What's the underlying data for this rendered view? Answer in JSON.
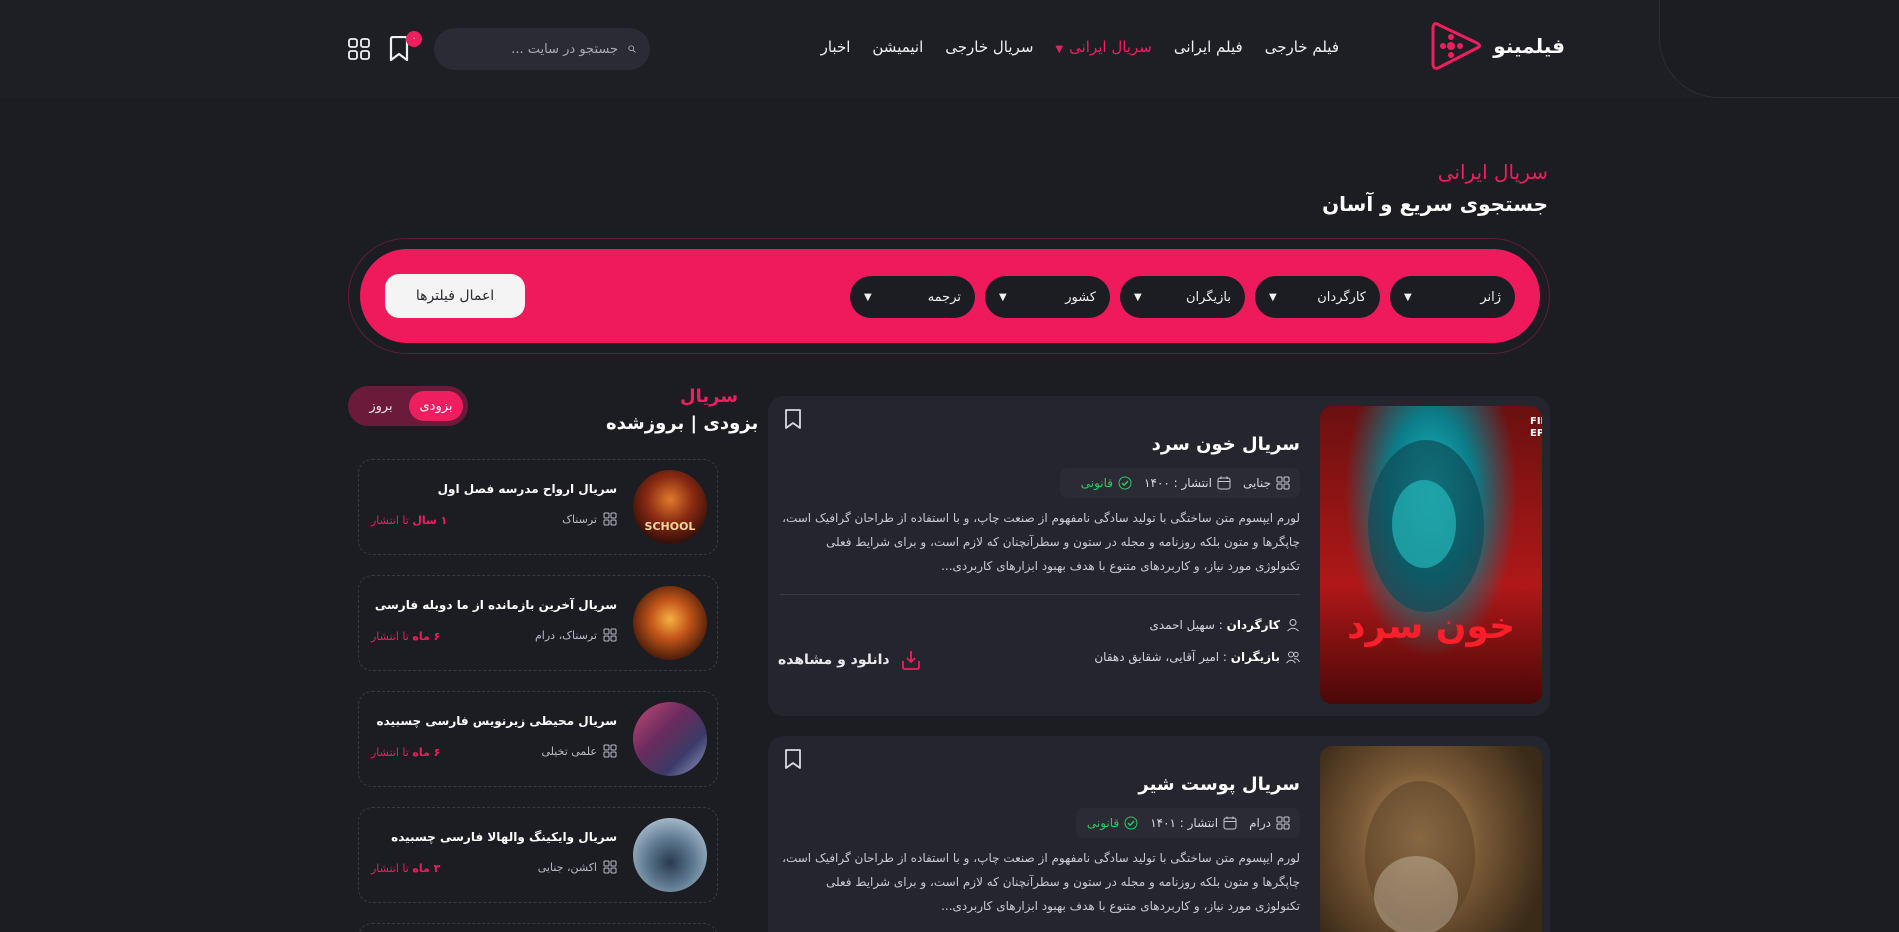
{
  "colors": {
    "accent": "#ef1e5e",
    "background": "#1c1c23",
    "card": "#25252d",
    "success": "#2ec76b"
  },
  "header": {
    "brand": "فیلمینو",
    "nav": [
      {
        "label": "فیلم خارجی"
      },
      {
        "label": "فیلم ایرانی"
      },
      {
        "label": "سریال ایرانی",
        "active": true
      },
      {
        "label": "سریال خارجی"
      },
      {
        "label": "انیمیشن"
      },
      {
        "label": "اخبار"
      }
    ],
    "search_placeholder": "جستجو در سایت ...",
    "bookmark_count": "۰"
  },
  "hero": {
    "label": "سریال ایرانی",
    "title": "جستجوی سریع و آسان"
  },
  "filters": {
    "items": [
      "ژانر",
      "کارگردان",
      "بازیگران",
      "کشور",
      "ترجمه"
    ],
    "apply_label": "اعمال فیلترها"
  },
  "sidebar": {
    "label": "سریال",
    "title": "بزودی | بروزشده",
    "toggle": {
      "on": "بزودی",
      "off": "بروز"
    },
    "items": [
      {
        "title": "سریال ارواح مدرسه فصل اول",
        "genre": "ترسناک",
        "time_num": "۱ سال",
        "time_suffix": " تا انتشار"
      },
      {
        "title": "سریال آخرین بازمانده از ما دوبله فارسی",
        "genre": "ترسناک، درام",
        "time_num": "۶ ماه",
        "time_suffix": " تا انتشار"
      },
      {
        "title": "سریال محیطی زیرنویس فارسی چسبیده",
        "genre": "علمی تخیلی",
        "time_num": "۶ ماه",
        "time_suffix": " تا انتشار"
      },
      {
        "title": "سریال وایکینگ والهالا فارسی چسبیده",
        "genre": "اکشن، جنایی",
        "time_num": "۳ ماه",
        "time_suffix": " تا انتشار"
      }
    ]
  },
  "cards": [
    {
      "title": "سریال خون سرد",
      "genre": "جنایی",
      "release": "انتشار : ۱۴۰۰",
      "status": "قانونی",
      "description": "لورم ایپسوم متن ساختگی با تولید سادگی نامفهوم از صنعت چاپ، و با استفاده از طراحان گرافیک است، چاپگرها و متون بلکه روزنامه و مجله در ستون و سطرآنچنان که لازم است، و برای شرایط فعلی تکنولوژی مورد نیاز، و کاربردهای متنوع با هدف بهبود ابزارهای کاربردی...",
      "director_label": "کارگردان",
      "director": " : سهیل احمدی",
      "cast_label": "بازیگران",
      "cast": " : امیر آقایی، شقایق دهقان",
      "download_label": "دانلود و مشاهده",
      "poster_text": "خون سرد",
      "poster_badge": "FINAL EPISODE"
    },
    {
      "title": "سریال پوست شیر",
      "genre": "درام",
      "release": "انتشار : ۱۴۰۱",
      "status": "قانونی",
      "description": "لورم ایپسوم متن ساختگی با تولید سادگی نامفهوم از صنعت چاپ، و با استفاده از طراحان گرافیک است، چاپگرها و متون بلکه روزنامه و مجله در ستون و سطرآنچنان که لازم است، و برای شرایط فعلی تکنولوژی مورد نیاز، و کاربردهای متنوع با هدف بهبود ابزارهای کاربردی..."
    }
  ]
}
